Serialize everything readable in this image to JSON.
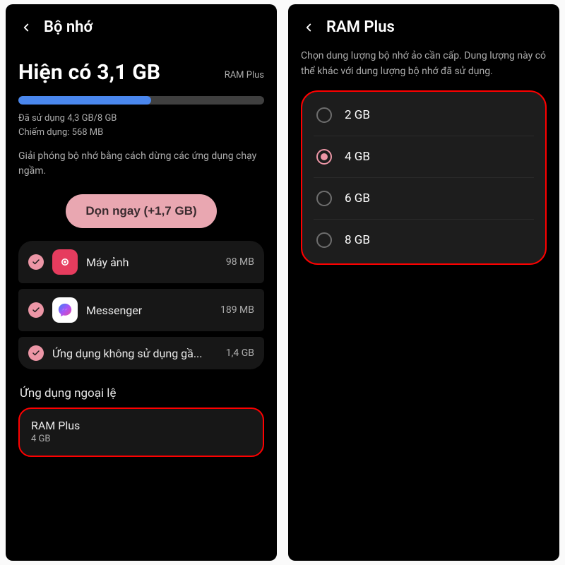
{
  "left": {
    "title": "Bộ nhớ",
    "hero": {
      "available": "Hiện có 3,1 GB",
      "right_label": "RAM Plus",
      "progress_pct": 54
    },
    "meta": {
      "used": "Đã sử dụng 4,3 GB/8 GB",
      "occupied": "Chiếm dụng: 568 MB"
    },
    "desc": "Giải phóng bộ nhớ bằng cách dừng các ứng dụng chạy ngầm.",
    "clean_button": "Dọn ngay (+1,7 GB)",
    "apps": {
      "camera": {
        "name": "Máy ảnh",
        "size": "98 MB"
      },
      "messenger": {
        "name": "Messenger",
        "size": "189 MB"
      },
      "unused": {
        "name": "Ứng dụng không sử dụng gầ...",
        "size": "1,4 GB"
      }
    },
    "excluded_label": "Ứng dụng ngoại lệ",
    "ramplus": {
      "title": "RAM Plus",
      "value": "4 GB"
    }
  },
  "right": {
    "title": "RAM Plus",
    "desc": "Chọn dung lượng bộ nhớ ảo cần cấp. Dung lượng này có thể khác với dung lượng bộ nhớ đã sử dụng.",
    "options": {
      "o1": "2 GB",
      "o2": "4 GB",
      "o3": "6 GB",
      "o4": "8 GB"
    },
    "selected": "4 GB"
  }
}
